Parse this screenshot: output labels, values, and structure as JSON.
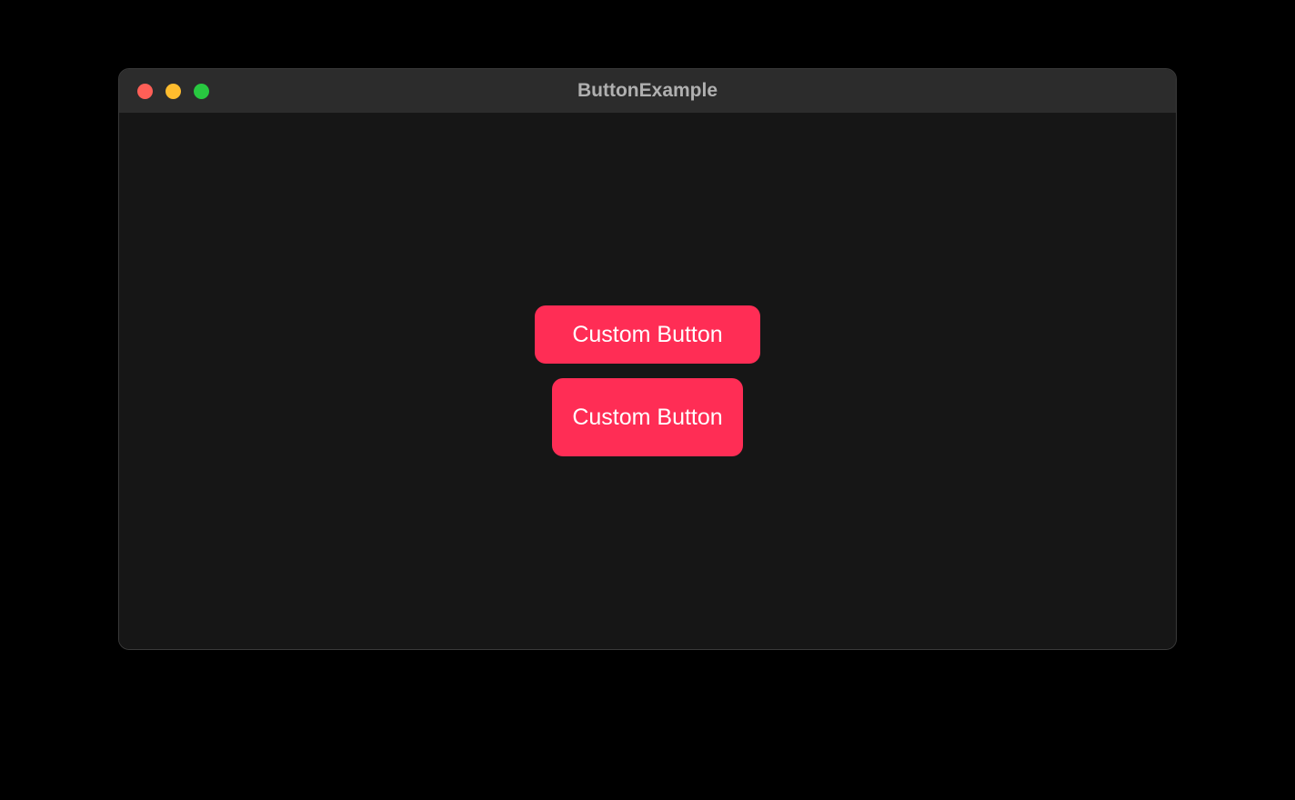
{
  "window": {
    "title": "ButtonExample"
  },
  "buttons": {
    "button1_label": "Custom Button",
    "button2_label": "Custom Button"
  },
  "colors": {
    "button_background": "#ff2d55",
    "button_text": "#ffffff",
    "window_background": "#161616",
    "titlebar_background": "#2c2c2c"
  }
}
